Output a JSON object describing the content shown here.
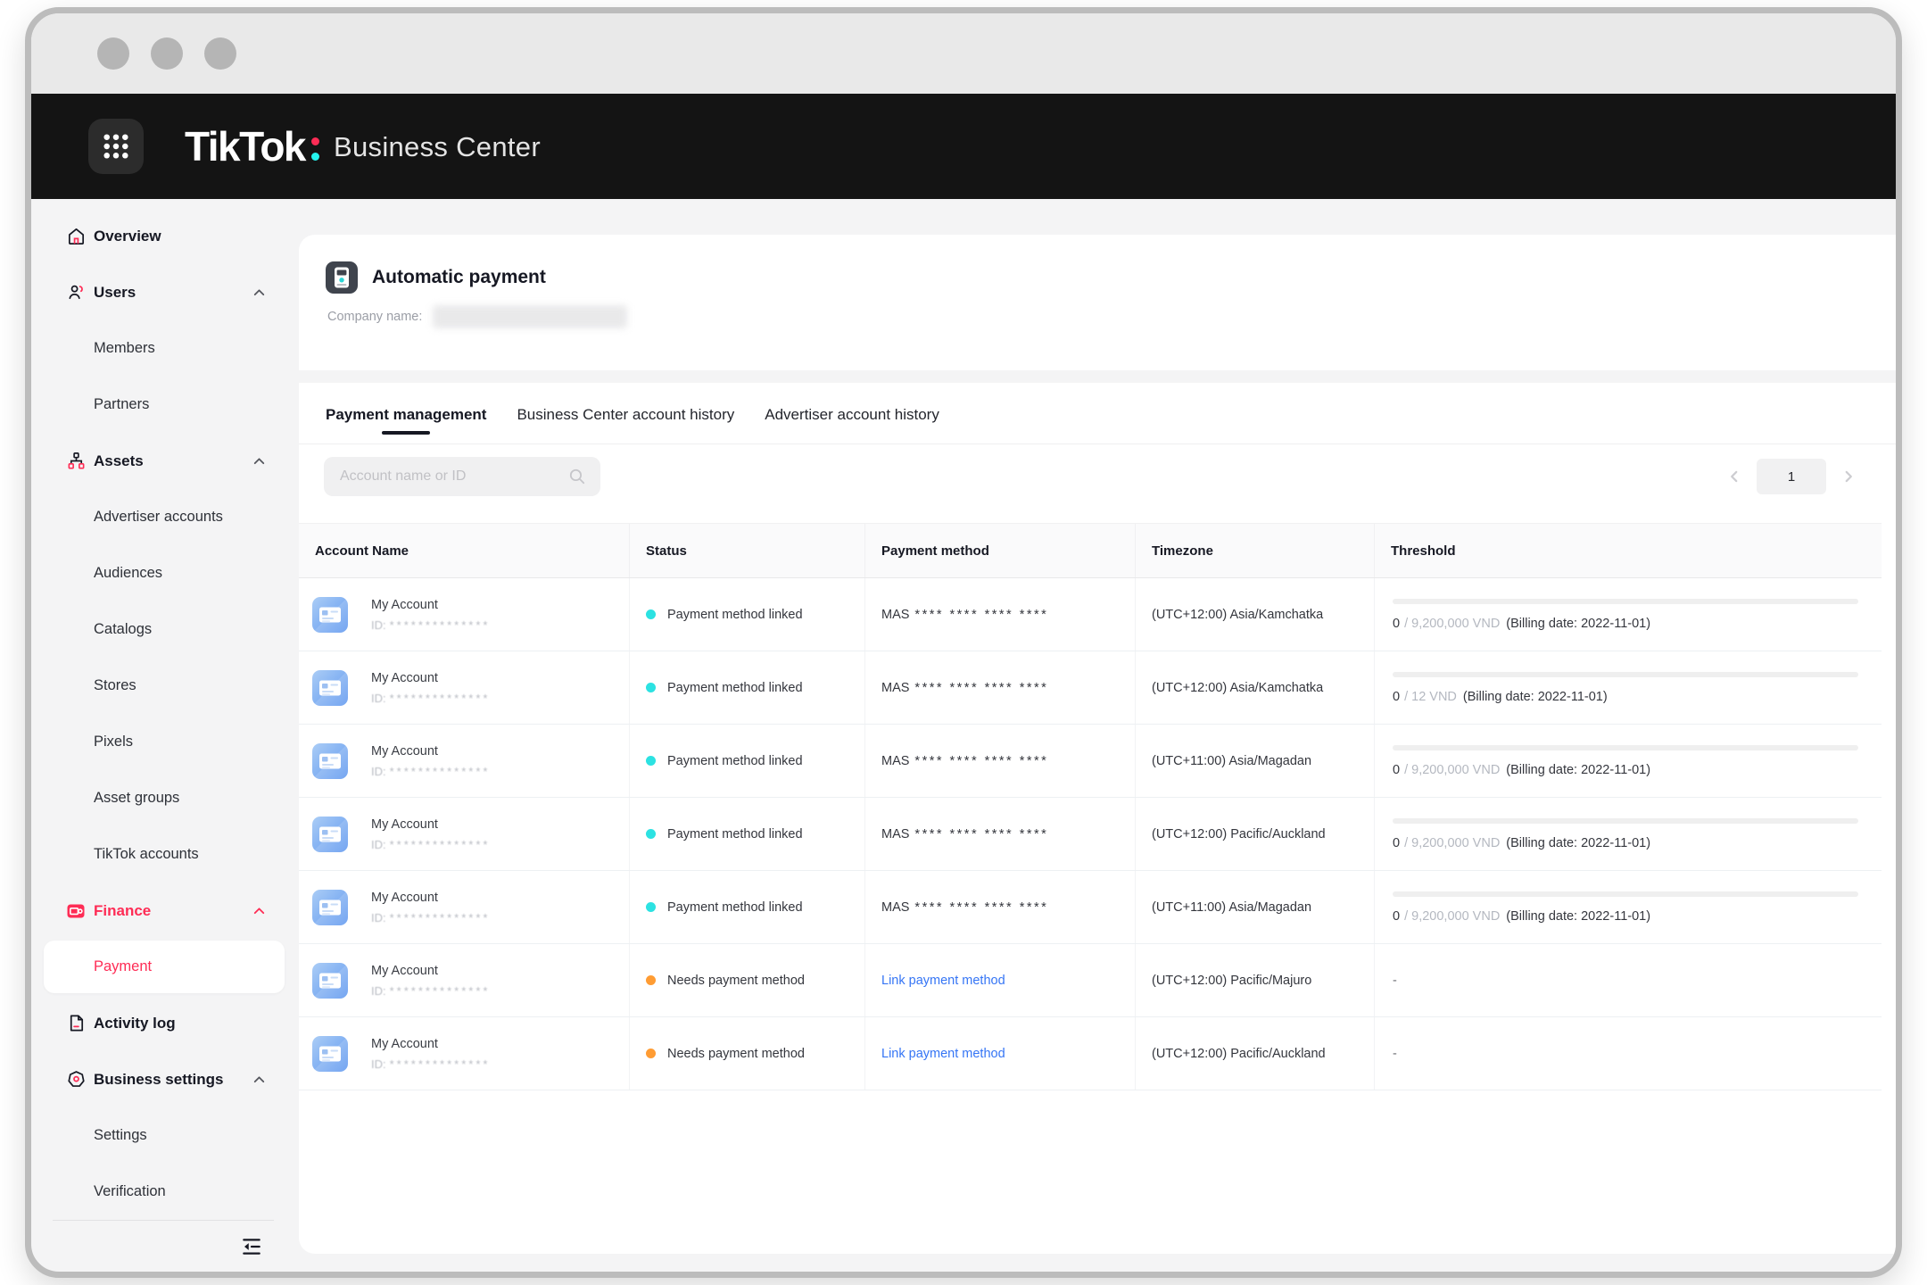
{
  "window": {
    "control_dots": 3
  },
  "topbar": {
    "logo": "TikTok",
    "product": "Business Center"
  },
  "colors": {
    "accent_pink": "#fe2c55",
    "logo_teal": "#25f4ee",
    "status_linked_dot": "#2ce2e2",
    "status_needs_dot": "#ff9c33",
    "link_blue": "#3575f5",
    "appbar_black": "#141414"
  },
  "sidebar": {
    "items": [
      {
        "label": "Overview",
        "icon": "home-icon",
        "level": "top"
      },
      {
        "label": "Users",
        "icon": "users-icon",
        "level": "top",
        "chevron": "up"
      },
      {
        "label": "Members",
        "level": "sub"
      },
      {
        "label": "Partners",
        "level": "sub"
      },
      {
        "label": "Assets",
        "icon": "assets-icon",
        "level": "top",
        "chevron": "up"
      },
      {
        "label": "Advertiser accounts",
        "level": "sub"
      },
      {
        "label": "Audiences",
        "level": "sub"
      },
      {
        "label": "Catalogs",
        "level": "sub"
      },
      {
        "label": "Stores",
        "level": "sub"
      },
      {
        "label": "Pixels",
        "level": "sub"
      },
      {
        "label": "Asset groups",
        "level": "sub"
      },
      {
        "label": "TikTok accounts",
        "level": "sub"
      },
      {
        "label": "Finance",
        "icon": "finance-icon",
        "level": "top",
        "chevron": "up",
        "accent": true
      },
      {
        "label": "Payment",
        "level": "sub",
        "selected": true
      },
      {
        "label": "Activity log",
        "icon": "activity-log-icon",
        "level": "top"
      },
      {
        "label": "Business settings",
        "icon": "business-settings-icon",
        "level": "top",
        "chevron": "up"
      },
      {
        "label": "Settings",
        "level": "sub"
      },
      {
        "label": "Verification",
        "level": "sub"
      }
    ]
  },
  "page_header": {
    "title": "Automatic payment",
    "company_label": "Company name:"
  },
  "tabs": [
    {
      "label": "Payment management",
      "active": true
    },
    {
      "label": "Business Center account history",
      "active": false
    },
    {
      "label": "Advertiser account history",
      "active": false
    }
  ],
  "toolbar": {
    "search_placeholder": "Account name or ID",
    "page_current": "1"
  },
  "table": {
    "columns": [
      "Account Name",
      "Status",
      "Payment method",
      "Timezone",
      "Threshold"
    ],
    "empty_value": "-",
    "rows": [
      {
        "account": {
          "name": "My Account",
          "id_prefix": "ID:",
          "id_mask": "**************"
        },
        "status": {
          "label": "Payment method linked",
          "type": "linked"
        },
        "payment": {
          "type": "card",
          "label": "MAS",
          "mask": "**** **** **** ****"
        },
        "timezone": "(UTC+12:00) Asia/Kamchatka",
        "threshold": {
          "used": "0",
          "limit": "/ 9,200,000 VND",
          "billing": "(Billing date: 2022-11-01)"
        }
      },
      {
        "account": {
          "name": "My Account",
          "id_prefix": "ID:",
          "id_mask": "**************"
        },
        "status": {
          "label": "Payment method linked",
          "type": "linked"
        },
        "payment": {
          "type": "card",
          "label": "MAS",
          "mask": "**** **** **** ****"
        },
        "timezone": "(UTC+12:00) Asia/Kamchatka",
        "threshold": {
          "used": "0",
          "limit": "/ 12 VND",
          "billing": "(Billing date: 2022-11-01)"
        }
      },
      {
        "account": {
          "name": "My Account",
          "id_prefix": "ID:",
          "id_mask": "**************"
        },
        "status": {
          "label": "Payment method linked",
          "type": "linked"
        },
        "payment": {
          "type": "card",
          "label": "MAS",
          "mask": "**** **** **** ****"
        },
        "timezone": "(UTC+11:00) Asia/Magadan",
        "threshold": {
          "used": "0",
          "limit": "/ 9,200,000 VND",
          "billing": "(Billing date: 2022-11-01)"
        }
      },
      {
        "account": {
          "name": "My Account",
          "id_prefix": "ID:",
          "id_mask": "**************"
        },
        "status": {
          "label": "Payment method linked",
          "type": "linked"
        },
        "payment": {
          "type": "card",
          "label": "MAS",
          "mask": "**** **** **** ****"
        },
        "timezone": "(UTC+12:00) Pacific/Auckland",
        "threshold": {
          "used": "0",
          "limit": "/ 9,200,000 VND",
          "billing": "(Billing date: 2022-11-01)"
        }
      },
      {
        "account": {
          "name": "My Account",
          "id_prefix": "ID:",
          "id_mask": "**************"
        },
        "status": {
          "label": "Payment method linked",
          "type": "linked"
        },
        "payment": {
          "type": "card",
          "label": "MAS",
          "mask": "**** **** **** ****"
        },
        "timezone": "(UTC+11:00) Asia/Magadan",
        "threshold": {
          "used": "0",
          "limit": "/ 9,200,000 VND",
          "billing": "(Billing date: 2022-11-01)"
        }
      },
      {
        "account": {
          "name": "My Account",
          "id_prefix": "ID:",
          "id_mask": "**************"
        },
        "status": {
          "label": "Needs payment method",
          "type": "needs"
        },
        "payment": {
          "type": "link",
          "label": "Link payment method"
        },
        "timezone": "(UTC+12:00) Pacific/Majuro",
        "threshold": null
      },
      {
        "account": {
          "name": "My Account",
          "id_prefix": "ID:",
          "id_mask": "**************"
        },
        "status": {
          "label": "Needs payment method",
          "type": "needs"
        },
        "payment": {
          "type": "link",
          "label": "Link payment method"
        },
        "timezone": "(UTC+12:00) Pacific/Auckland",
        "threshold": null
      }
    ]
  }
}
